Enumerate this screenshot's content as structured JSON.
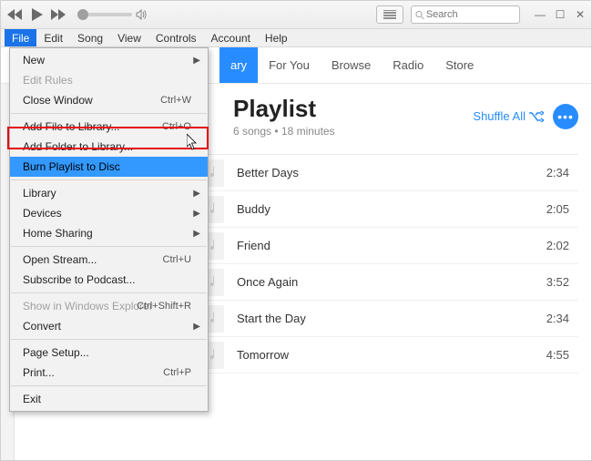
{
  "titlebar": {
    "search_placeholder": "Search"
  },
  "menubar": {
    "items": [
      "File",
      "Edit",
      "Song",
      "View",
      "Controls",
      "Account",
      "Help"
    ]
  },
  "tabs": {
    "items": [
      {
        "label": "Library",
        "active": true,
        "partial": "ary"
      },
      {
        "label": "For You"
      },
      {
        "label": "Browse"
      },
      {
        "label": "Radio"
      },
      {
        "label": "Store"
      }
    ]
  },
  "playlist": {
    "title": "Playlist",
    "subtitle": "6 songs • 18 minutes",
    "shuffle_label": "Shuffle All"
  },
  "tracks": [
    {
      "title": "Better Days",
      "duration": "2:34"
    },
    {
      "title": "Buddy",
      "duration": "2:05"
    },
    {
      "title": "Friend",
      "duration": "2:02"
    },
    {
      "title": "Once Again",
      "duration": "3:52"
    },
    {
      "title": "Start the Day",
      "duration": "2:34"
    },
    {
      "title": "Tomorrow",
      "duration": "4:55"
    }
  ],
  "file_menu": [
    {
      "label": "New",
      "submenu": true
    },
    {
      "label": "Edit Rules",
      "disabled": true
    },
    {
      "label": "Close Window",
      "shortcut": "Ctrl+W"
    },
    {
      "sep": true
    },
    {
      "label": "Add File to Library...",
      "shortcut": "Ctrl+O"
    },
    {
      "label": "Add Folder to Library..."
    },
    {
      "label": "Burn Playlist to Disc",
      "selected": true
    },
    {
      "sep": true
    },
    {
      "label": "Library",
      "submenu": true
    },
    {
      "label": "Devices",
      "submenu": true
    },
    {
      "label": "Home Sharing",
      "submenu": true
    },
    {
      "sep": true
    },
    {
      "label": "Open Stream...",
      "shortcut": "Ctrl+U"
    },
    {
      "label": "Subscribe to Podcast..."
    },
    {
      "sep": true
    },
    {
      "label": "Show in Windows Explorer",
      "shortcut": "Ctrl+Shift+R",
      "disabled": true
    },
    {
      "label": "Convert",
      "submenu": true
    },
    {
      "sep": true
    },
    {
      "label": "Page Setup..."
    },
    {
      "label": "Print...",
      "shortcut": "Ctrl+P"
    },
    {
      "sep": true
    },
    {
      "label": "Exit"
    }
  ]
}
